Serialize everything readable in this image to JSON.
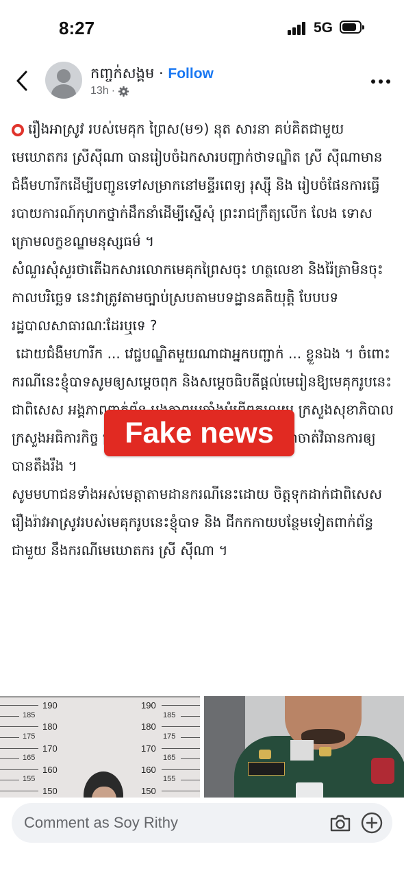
{
  "status_bar": {
    "time": "8:27",
    "network": "5G",
    "battery_level": 0.85
  },
  "header": {
    "author": "កញ្ចក់សង្គម",
    "separator": "·",
    "follow_label": "Follow",
    "timestamp": "13h",
    "meta_separator": "·",
    "privacy_icon": "gear-icon",
    "back_icon": "chevron-left-icon",
    "more_icon": "ellipsis-icon",
    "follow_color": "#1877f2"
  },
  "post": {
    "paragraphs": [
      "រឿងអាស្រូវ របស់មេគុក ព្រៃស(ម១) នុត សារនា គប់គិតជាមួយមេឃោតករ ស្រីស៊ីណា បានរៀបចំឯកសារបញ្ជាក់ថាទណ្ឌិត ស្រី ស៊ីណាមានជំងឺមហារីកដើម្បីបញ្ជូនទៅសម្រាកនៅមន្ទីរពេទ្យ រុស្ស៊ី និង រៀបចំផែនការធ្វើរបាយការណ៍កុហកថ្នាក់ដឹកនាំដើម្បីស្នើសុំ ព្រះរាជក្រឹត្យលើក លែង ទោសក្រោមលក្ខខណ្ឌមនុស្សធម៌ ។",
      "សំណួរសុំសួរថាតើឯកសារលោកមេគុកព្រៃសចុះ ហត្ថលេខា និងរ៉ៃត្រាមិនចុះ កាលបរិច្ឆេទ នេះវាត្រូវតាមច្បាប់ស្របតាមបទដ្ឋានគតិយុត្តិ បែបបទរដ្ឋបាលសាធារណៈដែរឬទេ ?",
      " ដោយជំងឺមហារីក ... វេជ្ជបណ្ឌិតមួយណាជាអ្នកបញ្ជាក់ ... ខ្លួនឯង ។ ចំពោះករណីនេះខ្ញុំបាទសូមឲ្យសម្ដេចពុក និងសម្ដេចធិបតីផ្ដល់មេរៀនឱ្យមេគុករូបនេះ ជាពិសេស អង្គភាពពាក់ព័ន្ធ អង្គភាពប្រឆាំងអំពើពុករលួយ ក្រសួងសុខាភិបាល ក្រសួងអធិការកិច្ច ក្រសួងយុត្តិធម៌និងក្រសួងមហាផ្ទៃ មេត្តាចាត់វិធានការឲ្យបានតឹងរឹង ។",
      "សូមមហាជនទាំងអស់មេត្តាតាមដានករណីនេះដោយ ចិត្តទុកដាក់ជាពិសេសរឿងរ៉ាវអាស្រូវរបស់មេគុករូបនេះខ្ញុំបាទ និង ជីកកកាយបន្ថែមទៀតពាក់ព័ន្ធជាមួយ នឹងករណីមេឃោតករ ស្រី ស៊ីណា ។"
    ],
    "lead_icon": "red-circle-icon",
    "overlay_label": "Fake news",
    "overlay_color": "#e12a22"
  },
  "photos": {
    "left_ruler_major": [
      "190",
      "180",
      "170",
      "160",
      "150"
    ],
    "left_ruler_minor": [
      "185",
      "175",
      "165",
      "155"
    ],
    "right_ruler_major": [
      "190",
      "180",
      "170",
      "160",
      "150"
    ],
    "right_ruler_minor": [
      "185",
      "175",
      "165",
      "155"
    ]
  },
  "comment": {
    "placeholder": "Comment as Soy Rithy",
    "camera_icon": "camera-icon",
    "add_icon": "plus-circle-icon"
  }
}
